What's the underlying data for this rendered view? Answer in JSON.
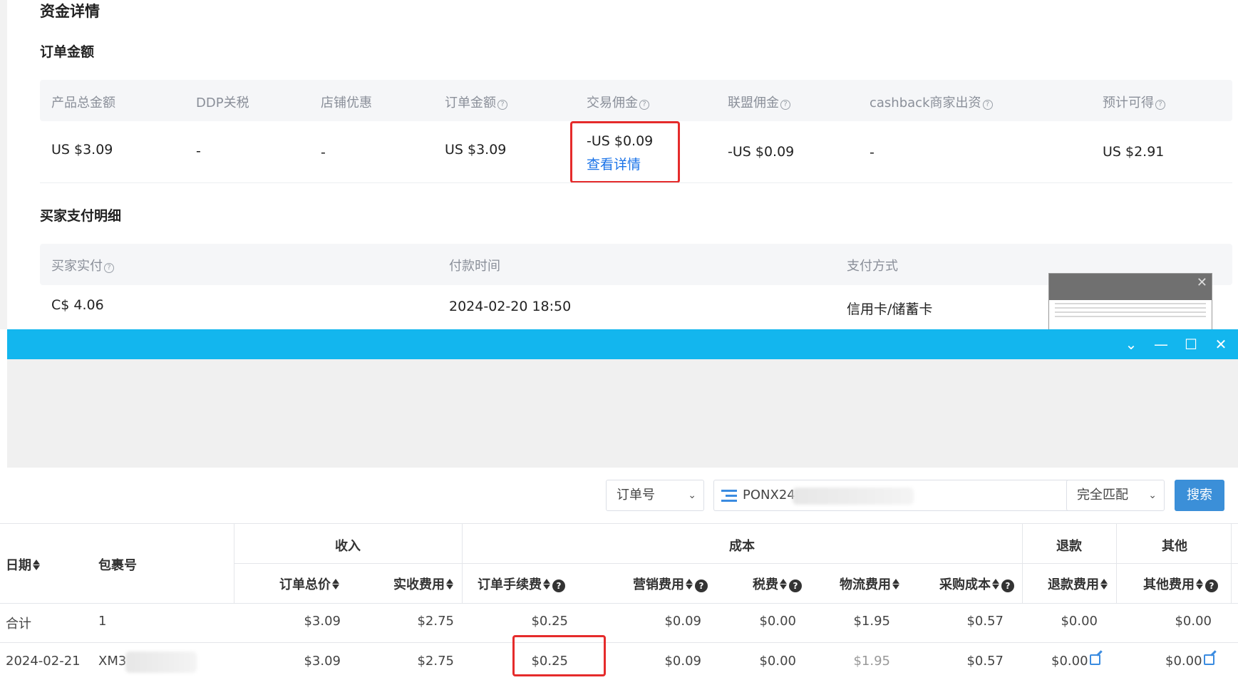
{
  "page": {
    "title": "资金详情",
    "order_amount_section": "订单金额",
    "buyer_payment_section": "买家支付明细"
  },
  "order_table": {
    "headers": [
      "产品总金额",
      "DDP关税",
      "店铺优惠",
      "订单金额",
      "交易佣金",
      "联盟佣金",
      "cashback商家出资",
      "预计可得"
    ],
    "row": [
      "US $3.09",
      "-",
      "-",
      "US $3.09",
      "-US $0.09",
      "-US $0.09",
      "-",
      "US $2.91"
    ],
    "view_detail_link": "查看详情"
  },
  "buyer_table": {
    "headers": [
      "买家实付",
      "付款时间",
      "支付方式"
    ],
    "row": [
      "C$ 4.06",
      "2024-02-20 18:50",
      "信用卡/储蓄卡"
    ]
  },
  "window": {
    "controls": [
      "chevron-down",
      "minimize",
      "maximize",
      "close"
    ],
    "accent": "#13b6ee"
  },
  "search": {
    "field_select": "订单号",
    "query_value": "PONX24",
    "match_select": "完全匹配",
    "button_label": "搜索"
  },
  "finance_table": {
    "group_headers": {
      "income": "收入",
      "cost": "成本",
      "refund": "退款",
      "other": "其他"
    },
    "columns": {
      "date": "日期",
      "package": "包裹号",
      "order_total": "订单总价",
      "received": "实收费用",
      "order_fee": "订单手续费",
      "marketing": "营销费用",
      "tax": "税费",
      "logistics": "物流费用",
      "purchase": "采购成本",
      "refund_fee": "退款费用",
      "other_fee": "其他费用"
    },
    "total_row": {
      "date": "合计",
      "package": "1",
      "order_total": "$3.09",
      "received": "$2.75",
      "order_fee": "$0.25",
      "marketing": "$0.09",
      "tax": "$0.00",
      "logistics": "$1.95",
      "purchase": "$0.57",
      "refund_fee": "$0.00",
      "other_fee": "$0.00"
    },
    "data_row": {
      "date": "2024-02-21",
      "package": "XM3",
      "order_total": "$3.09",
      "received": "$2.75",
      "order_fee": "$0.25",
      "marketing": "$0.09",
      "tax": "$0.00",
      "logistics": "$1.95",
      "purchase": "$0.57",
      "refund_fee": "$0.00",
      "other_fee": "$0.00"
    }
  }
}
